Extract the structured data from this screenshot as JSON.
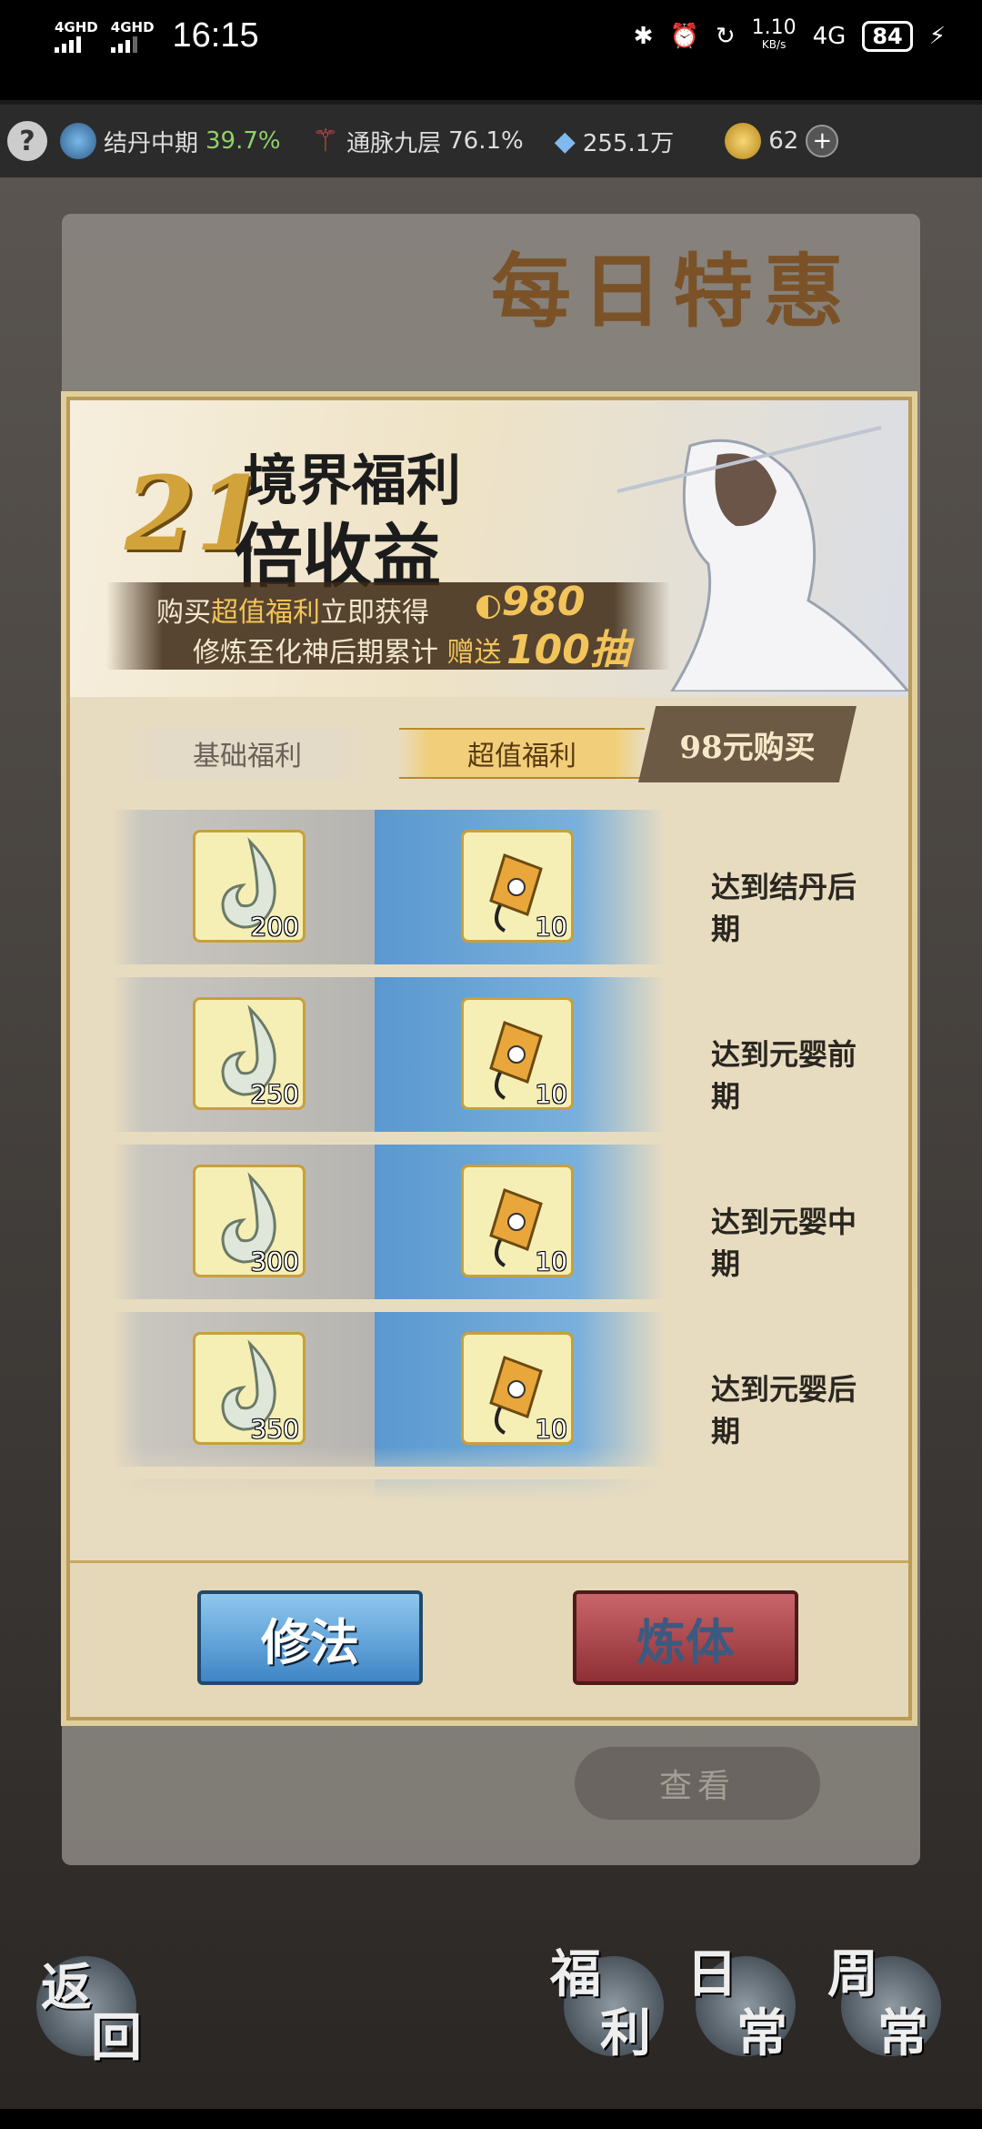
{
  "status_bar": {
    "network1": "4GHD",
    "network2": "4GHD",
    "time": "16:15",
    "speed_value": "1.10",
    "speed_unit": "KB/s",
    "mobile": "4G",
    "battery": "84"
  },
  "resources": {
    "help": "?",
    "cultivation_label": "结丹中期",
    "cultivation_pct": "39.7%",
    "meridian_label": "通脉九层",
    "meridian_pct": "76.1%",
    "crystals": "255.1万",
    "tokens": "62",
    "plus": "+"
  },
  "scene": {
    "title": "每日特惠",
    "view_button": "查看",
    "nav": {
      "back1": "返",
      "back2": "回",
      "welfare1": "福",
      "welfare2": "利",
      "daily1": "日",
      "daily2": "常",
      "weekly1": "周",
      "weekly2": "常"
    }
  },
  "banner": {
    "title_top": "境界福利",
    "multiplier": "21",
    "title_bottom": "倍收益",
    "line1_prefix": "购买",
    "line1_highlight": "超值福利",
    "line1_suffix": "立即获得",
    "line1_amount": "980",
    "line2_prefix": "修炼至化神后期累计",
    "line2_highlight": "赠送",
    "line2_amount": "100抽"
  },
  "tabs": {
    "basic": "基础福利",
    "value": "超值福利",
    "buy": "98元购买"
  },
  "rewards": [
    {
      "item_a_qty": "200",
      "item_b_qty": "10",
      "condition": "达到结丹后期"
    },
    {
      "item_a_qty": "250",
      "item_b_qty": "10",
      "condition": "达到元婴前期"
    },
    {
      "item_a_qty": "300",
      "item_b_qty": "10",
      "condition": "达到元婴中期"
    },
    {
      "item_a_qty": "350",
      "item_b_qty": "10",
      "condition": "达到元婴后期"
    }
  ],
  "footer": {
    "cultivate": "修法",
    "body_refine": "炼体"
  }
}
